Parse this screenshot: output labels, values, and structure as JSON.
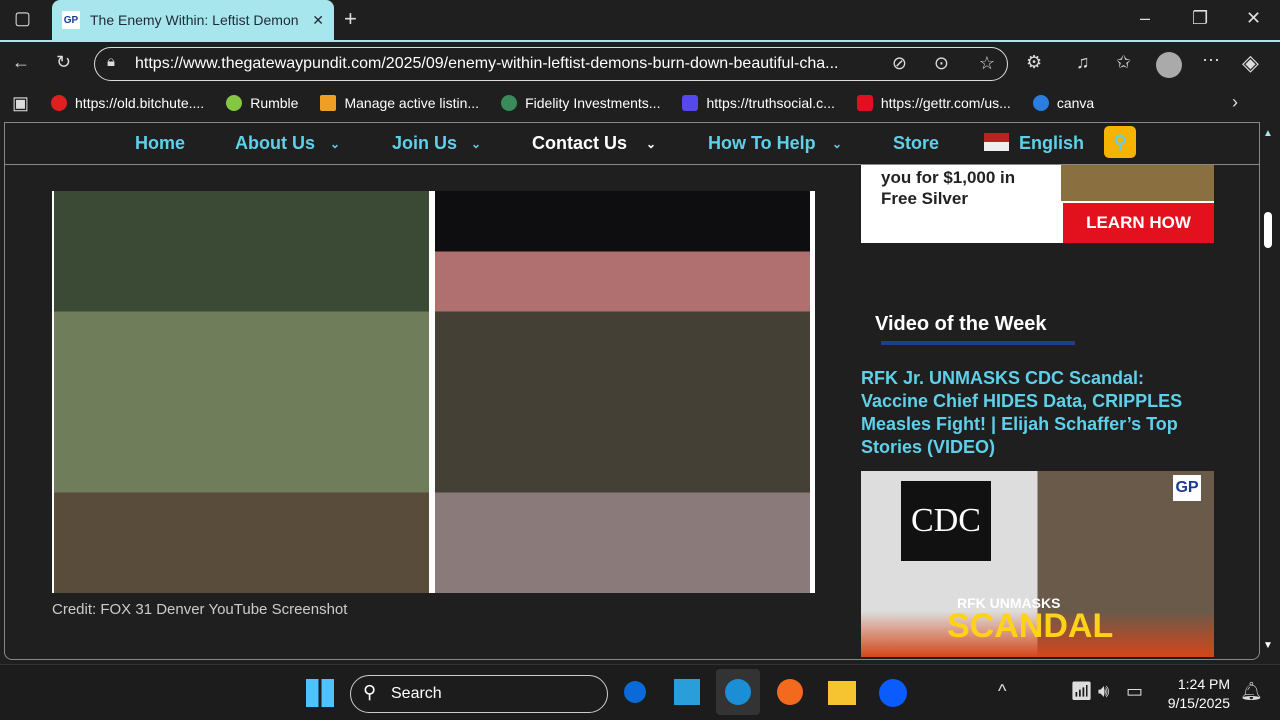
{
  "browser": {
    "tab_title": "The Enemy Within: Leftist Demon",
    "tab_favicon": "GP",
    "url": "https://www.thegatewaypundit.com/2025/09/enemy-within-leftist-demons-burn-down-beautiful-cha...",
    "bookmarks": [
      {
        "label": "https://old.bitchute....",
        "color": "#e02020"
      },
      {
        "label": "Rumble",
        "color": "#85c742"
      },
      {
        "label": "Manage active listin...",
        "color": "#f0a020"
      },
      {
        "label": "Fidelity Investments...",
        "color": "#3a8a5a"
      },
      {
        "label": "https://truthsocial.c...",
        "color": "#5448ee"
      },
      {
        "label": "https://gettr.com/us...",
        "color": "#e01020"
      },
      {
        "label": "canva",
        "color": "#2a7de1"
      }
    ]
  },
  "nav": {
    "items": [
      "Home",
      "About Us",
      "Join Us",
      "Contact Us",
      "How To Help",
      "Store",
      "English"
    ]
  },
  "article": {
    "credit": "Credit: FOX 31 Denver YouTube Screenshot"
  },
  "sidebar": {
    "ad_text_1": "you for $1,000 in",
    "ad_text_2": "Free Silver",
    "ad_button": "LEARN HOW",
    "video_heading": "Video of the Week",
    "story_title": "RFK Jr. UNMASKS CDC Scandal: Vaccine Chief HIDES Data, CRIPPLES Measles Fight! | Elijah Schaffer’s Top Stories (VIDEO)",
    "thumb_text_1": "RFK UNMASKS",
    "thumb_text_2": "SCANDAL",
    "thumb_logo": "CDC",
    "thumb_badge": "GP"
  },
  "taskbar": {
    "search": "Search",
    "time": "1:24 PM",
    "date": "9/15/2025"
  },
  "colors": {
    "accent": "#5fd0ea",
    "tab": "#a8e6ee",
    "ad_red": "#e3101e"
  }
}
